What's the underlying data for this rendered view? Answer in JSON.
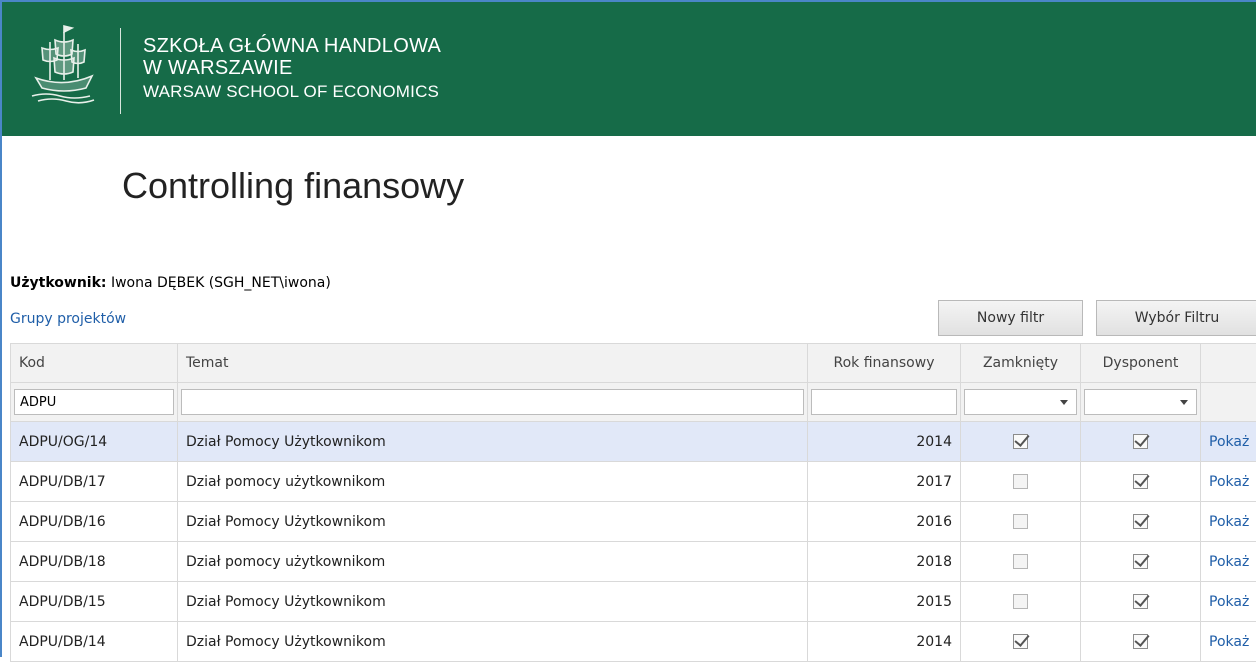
{
  "header": {
    "logo_icon": "ship-emblem-icon",
    "line1": "SZKOŁA GŁÓWNA HANDLOWA",
    "line2": "W WARSZAWIE",
    "line3": "WARSAW SCHOOL OF ECONOMICS"
  },
  "page_title": "Controlling finansowy",
  "user": {
    "label": "Użytkownik:",
    "value": "Iwona DĘBEK (SGH_NET\\iwona)"
  },
  "groups_link": "Grupy projektów",
  "buttons": {
    "new_filter": "Nowy filtr",
    "choose_filter": "Wybór Filtru"
  },
  "grid": {
    "columns": [
      "Kod",
      "Temat",
      "Rok finansowy",
      "Zamknięty",
      "Dysponent",
      ""
    ],
    "filters": {
      "kod": "ADPU",
      "temat": "",
      "rok": ""
    },
    "rows": [
      {
        "kod": "ADPU/OG/14",
        "temat": "Dział Pomocy Użytkownikom",
        "rok": "2014",
        "zamkniety": true,
        "dysponent": true,
        "action": "Pokaż"
      },
      {
        "kod": "ADPU/DB/17",
        "temat": "Dział pomocy użytkownikom",
        "rok": "2017",
        "zamkniety": false,
        "dysponent": true,
        "action": "Pokaż"
      },
      {
        "kod": "ADPU/DB/16",
        "temat": "Dział Pomocy Użytkownikom",
        "rok": "2016",
        "zamkniety": false,
        "dysponent": true,
        "action": "Pokaż"
      },
      {
        "kod": "ADPU/DB/18",
        "temat": "Dział pomocy użytkownikom",
        "rok": "2018",
        "zamkniety": false,
        "dysponent": true,
        "action": "Pokaż"
      },
      {
        "kod": "ADPU/DB/15",
        "temat": "Dział Pomocy Użytkownikom",
        "rok": "2015",
        "zamkniety": false,
        "dysponent": true,
        "action": "Pokaż"
      },
      {
        "kod": "ADPU/DB/14",
        "temat": "Dział Pomocy Użytkownikom",
        "rok": "2014",
        "zamkniety": true,
        "dysponent": true,
        "action": "Pokaż"
      }
    ]
  },
  "colors": {
    "header_bg": "#166b48",
    "link": "#1f5ea8",
    "selected_row": "#e1e8f8"
  }
}
